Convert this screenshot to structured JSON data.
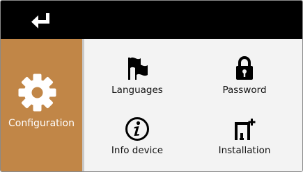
{
  "sidebar": {
    "active_item": {
      "label": "Configuration",
      "icon": "gear-icon",
      "color": "#c18647"
    }
  },
  "header": {
    "back_icon": "return-arrow-icon",
    "background": "#000000"
  },
  "menu": {
    "items": [
      {
        "label": "Languages",
        "icon": "flags-icon"
      },
      {
        "label": "Password",
        "icon": "padlock-icon"
      },
      {
        "label": "Info device",
        "icon": "info-icon"
      },
      {
        "label": "Installation",
        "icon": "frame-plus-icon"
      }
    ]
  }
}
